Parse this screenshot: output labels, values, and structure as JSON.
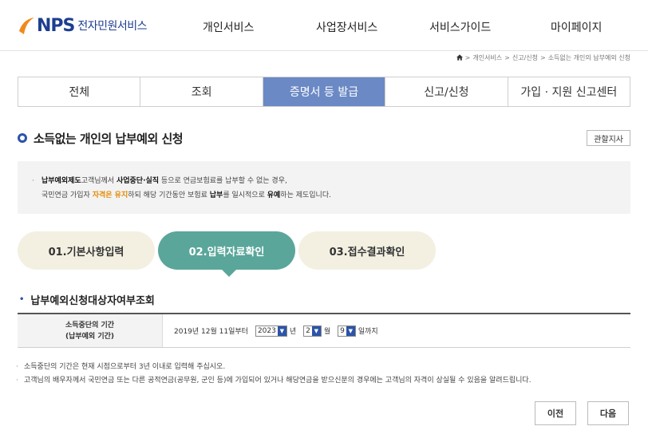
{
  "header": {
    "logo_text": "NPS",
    "logo_sub": "전자민원서비스",
    "nav": [
      "개인서비스",
      "사업장서비스",
      "서비스가이드",
      "마이페이지"
    ]
  },
  "breadcrumb": {
    "items": [
      "개인서비스",
      "신고/신청",
      "소득없는 개인의 납부예외 신청"
    ],
    "separator": ">"
  },
  "tabs": [
    {
      "label": "전체",
      "active": false
    },
    {
      "label": "조회",
      "active": false
    },
    {
      "label": "증명서 등 발급",
      "active": true
    },
    {
      "label": "신고/신청",
      "active": false
    },
    {
      "label": "가입 · 지원 신고센터",
      "active": false
    }
  ],
  "page": {
    "title": "소득없는 개인의 납부예외 신청",
    "office_button": "관할지사"
  },
  "info": {
    "line1_a": "납부예외제도",
    "line1_b": "고객님께서 ",
    "line1_c": "사업중단·실직",
    "line1_d": " 등으로 연금보험료를 납부할 수 없는 경우,",
    "line2_a": "국민연금 가입자 ",
    "line2_b": "자격은 유지",
    "line2_c": "하되 해당 기간동안 보험료 ",
    "line2_d": "납부",
    "line2_e": "를 일시적으로 ",
    "line2_f": "유예",
    "line2_g": "하는 제도입니다."
  },
  "steps": [
    {
      "label": "01.기본사항입력",
      "active": false
    },
    {
      "label": "02.입력자료확인",
      "active": true
    },
    {
      "label": "03.접수결과확인",
      "active": false
    }
  ],
  "section": {
    "title": "납부예외신청대상자여부조회",
    "row_label_1": "소득중단의 기간",
    "row_label_2": "(납부예외 기간)",
    "from_text": "2019년 12월 11일부터",
    "year_value": "2023",
    "year_unit": "년",
    "month_value": "2",
    "month_unit": "월",
    "day_value": "9",
    "day_unit": "일까지"
  },
  "notes": [
    "소득중단의 기간은 현재 시점으로부터 3년 이내로 입력해 주십시오.",
    "고객님의 배우자께서 국민연금 또는 다른 공적연금(공무원, 군인 등)에 가입되어 있거나 해당연금을 받으신분의 경우에는 고객님의 자격이 상실될 수 있음을 알려드립니다."
  ],
  "buttons": {
    "prev": "이전",
    "next": "다음"
  },
  "colors": {
    "brand": "#1d3e8f",
    "tab_active": "#6b89c5",
    "step_active": "#5aa69a",
    "step_inactive": "#f3f0e2",
    "highlight": "#e58a00"
  }
}
